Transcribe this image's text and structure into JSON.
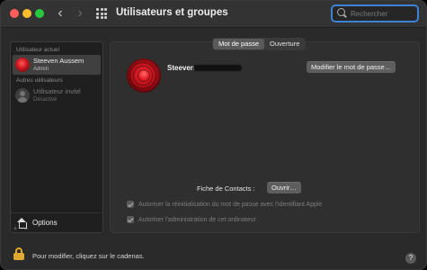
{
  "window": {
    "title": "Utilisateurs et groupes",
    "nav_back": "‹",
    "nav_forward": "›"
  },
  "search": {
    "placeholder": "Rechercher",
    "value": ""
  },
  "sidebar": {
    "current_section": "Utilisateur actuel",
    "current_user": {
      "name": "Steeven Aussem",
      "role": "Admin"
    },
    "other_section": "Autres utilisateurs",
    "guest_user": {
      "name": "Utilisateur invité",
      "status": "Désactivé"
    },
    "options_label": "Options",
    "add_label": "+",
    "remove_label": "−"
  },
  "main": {
    "tabs": [
      {
        "label": "Mot de passe",
        "active": true
      },
      {
        "label": "Ouverture",
        "active": false
      }
    ],
    "user_name": "Steeven",
    "change_password_label": "Modifier le mot de passe…",
    "contacts_label": "Fiche de Contacts :",
    "open_label": "Ouvrir…",
    "checkboxes": [
      {
        "label": "Autoriser la réinitialisation du mot de passe avec l'identifiant Apple",
        "checked": true,
        "disabled": true
      },
      {
        "label": "Autoriser l'administration de cet ordinateur",
        "checked": true,
        "disabled": true
      }
    ]
  },
  "footer": {
    "lock_text": "Pour modifier, cliquez sur le cadenas.",
    "help_label": "?"
  },
  "colors": {
    "accent": "#3b82d6",
    "lock": "#e0a82e",
    "close": "#ff5f57",
    "minimize": "#febc2e",
    "maximize": "#28c840"
  }
}
